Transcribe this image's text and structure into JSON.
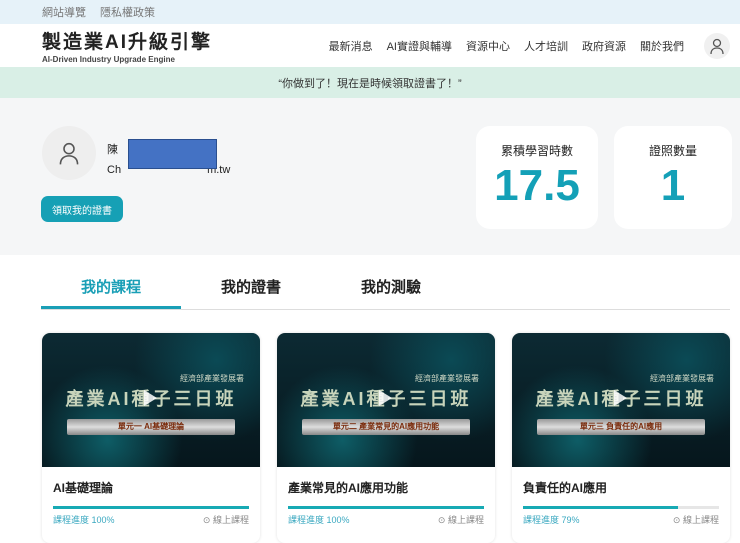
{
  "topbar": {
    "links": [
      "網站導覽",
      "隱私權政策"
    ]
  },
  "header": {
    "title": "製造業AI升級引擎",
    "subtitle": "AI-Driven Industry Upgrade Engine",
    "nav": [
      "最新消息",
      "AI實證與輔導",
      "資源中心",
      "人才培訓",
      "政府資源",
      "關於我們"
    ]
  },
  "banner": "“你做到了！現在是時候領取證書了！”",
  "profile": {
    "name": "陳",
    "email_start": "Ch",
    "email_end": "m.tw",
    "claim_button": "領取我的證書"
  },
  "stats": [
    {
      "label": "累積學習時數",
      "value": "17.5"
    },
    {
      "label": "證照數量",
      "value": "1"
    }
  ],
  "tabs": [
    "我的課程",
    "我的證書",
    "我的測驗"
  ],
  "courses": [
    {
      "title": "AI基礎理論",
      "progress_label": "課程進度 100%",
      "progress": 100,
      "type": "線上課程",
      "thumb_org": "經濟部產業發展署",
      "thumb_title": "產業AI種子三日班",
      "thumb_unit": "單元一 AI基礎理論"
    },
    {
      "title": "產業常見的AI應用功能",
      "progress_label": "課程進度 100%",
      "progress": 100,
      "type": "線上課程",
      "thumb_org": "經濟部產業發展署",
      "thumb_title": "產業AI種子三日班",
      "thumb_unit": "單元二 產業常見的AI應用功能"
    },
    {
      "title": "負責任的AI應用",
      "progress_label": "課程進度 79%",
      "progress": 79,
      "type": "線上課程",
      "thumb_org": "經濟部產業發展署",
      "thumb_title": "產業AI種子三日班",
      "thumb_unit": "單元三 負責任的AI應用"
    }
  ]
}
